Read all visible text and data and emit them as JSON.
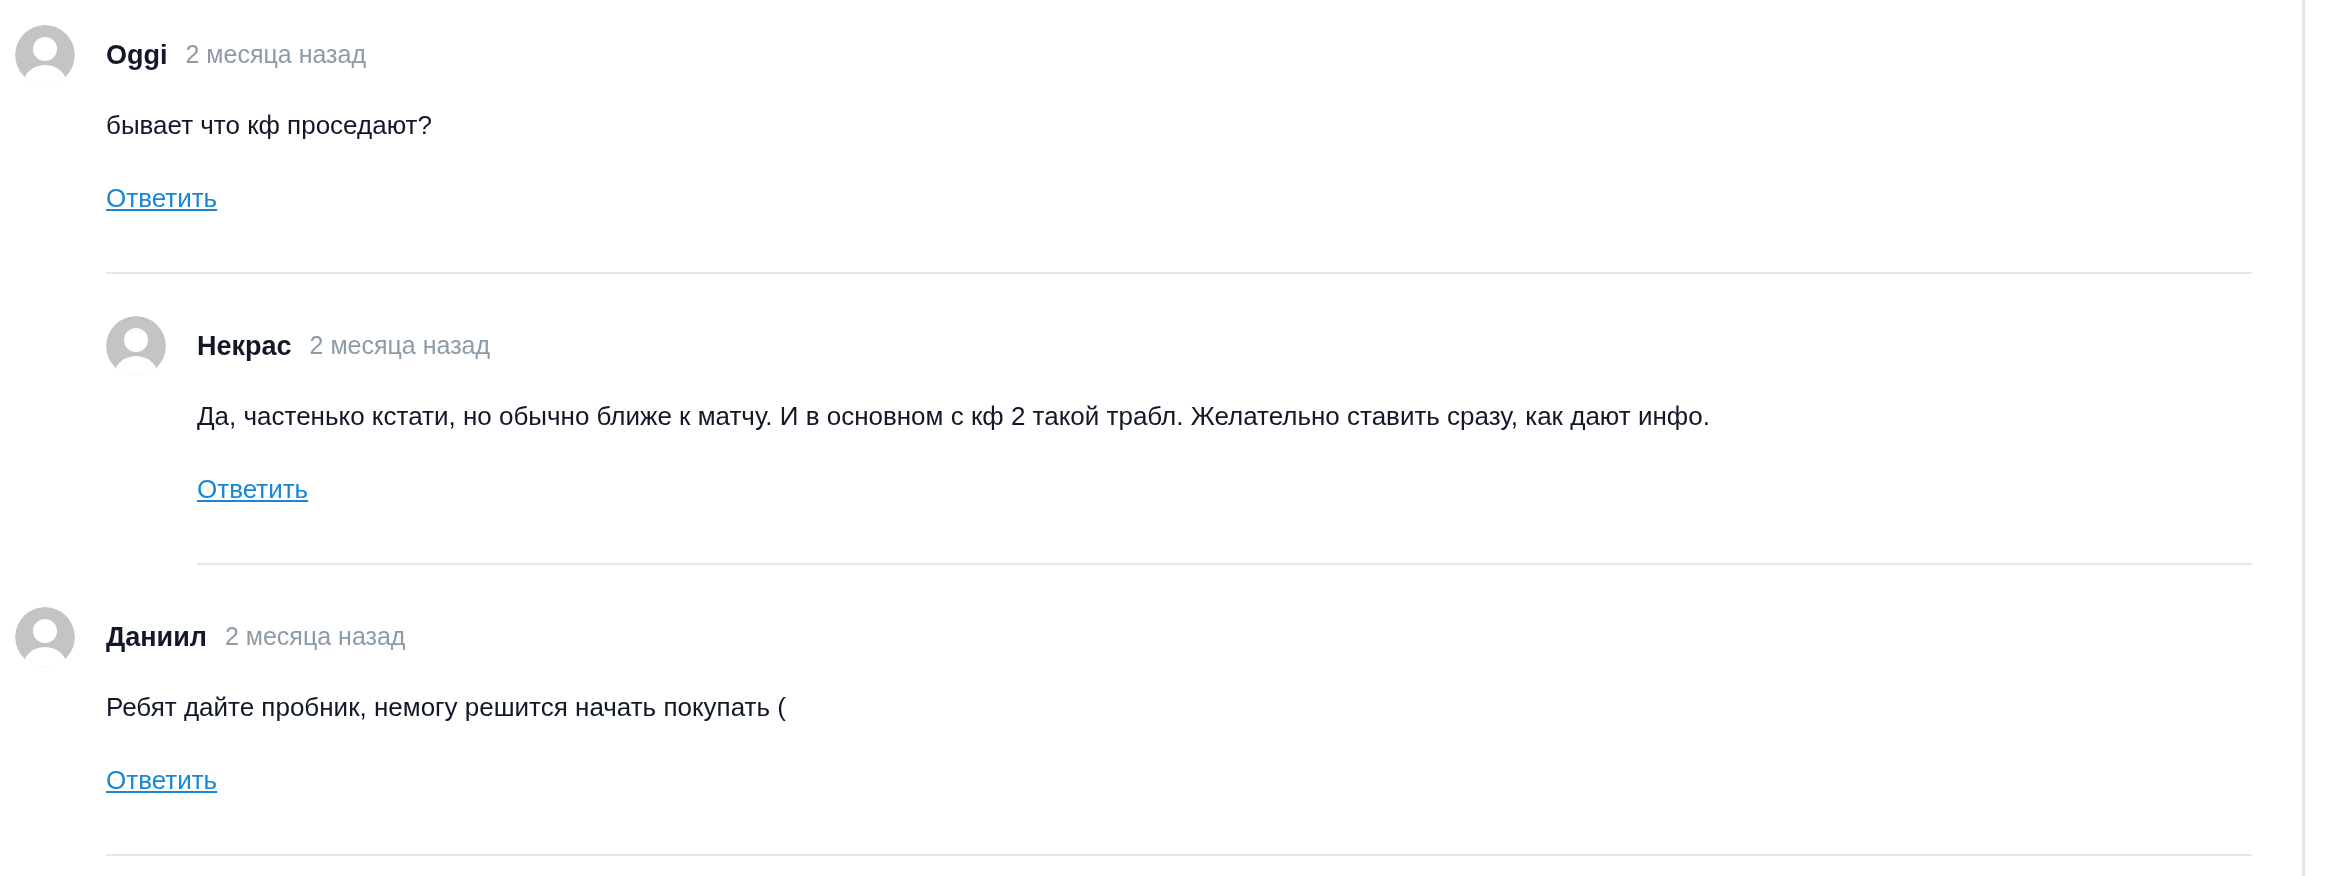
{
  "comments": [
    {
      "author": "Oggi",
      "date": "2 месяца назад",
      "text": "бывает что кф проседают?",
      "reply": "Ответить",
      "children": [
        {
          "author": "Некрас",
          "date": "2 месяца назад",
          "text": "Да, частенько кстати, но обычно ближе к матчу. И в основном с кф 2 такой трабл. Желательно ставить сразу, как дают инфо.",
          "reply": "Ответить"
        }
      ]
    },
    {
      "author": "Даниил",
      "date": "2 месяца назад",
      "text": "Ребят дайте пробник, немогу решится начать покупать (",
      "reply": "Ответить"
    }
  ]
}
